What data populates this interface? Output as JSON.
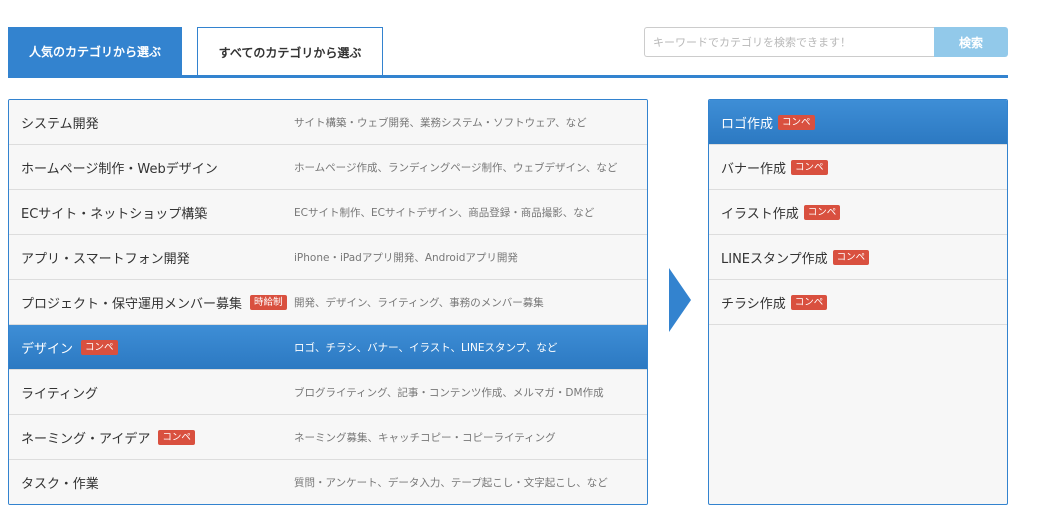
{
  "tabs": {
    "popular_label": "人気のカテゴリから選ぶ",
    "all_label": "すべてのカテゴリから選ぶ"
  },
  "search": {
    "placeholder": "キーワードでカテゴリを検索できます！",
    "button_label": "検索"
  },
  "categories": [
    {
      "name": "システム開発",
      "badge": "",
      "desc": "サイト構築・ウェブ開発、業務システム・ソフトウェア、など"
    },
    {
      "name": "ホームページ制作・Webデザイン",
      "badge": "",
      "desc": "ホームページ作成、ランディングページ制作、ウェブデザイン、など"
    },
    {
      "name": "ECサイト・ネットショップ構築",
      "badge": "",
      "desc": "ECサイト制作、ECサイトデザイン、商品登録・商品撮影、など"
    },
    {
      "name": "アプリ・スマートフォン開発",
      "badge": "",
      "desc": "iPhone・iPadアプリ開発、Androidアプリ開発"
    },
    {
      "name": "プロジェクト・保守運用メンバー募集",
      "badge": "時給制",
      "desc": "開発、デザイン、ライティング、事務のメンバー募集"
    },
    {
      "name": "デザイン",
      "badge": "コンペ",
      "desc": "ロゴ、チラシ、バナー、イラスト、LINEスタンプ、など"
    },
    {
      "name": "ライティング",
      "badge": "",
      "desc": "ブログライティング、記事・コンテンツ作成、メルマガ・DM作成"
    },
    {
      "name": "ネーミング・アイデア",
      "badge": "コンペ",
      "desc": "ネーミング募集、キャッチコピー・コピーライティング"
    },
    {
      "name": "タスク・作業",
      "badge": "",
      "desc": "質問・アンケート、データ入力、テープ起こし・文字起こし、など"
    }
  ],
  "selected_category_index": 5,
  "subcategories": [
    {
      "name": "ロゴ作成",
      "badge": "コンペ"
    },
    {
      "name": "バナー作成",
      "badge": "コンペ"
    },
    {
      "name": "イラスト作成",
      "badge": "コンペ"
    },
    {
      "name": "LINEスタンプ作成",
      "badge": "コンペ"
    },
    {
      "name": "チラシ作成",
      "badge": "コンペ"
    }
  ],
  "selected_subcategory_index": 0,
  "colors": {
    "accent": "#3383cf",
    "badge": "#d9503f",
    "search_button": "#92c9ea"
  }
}
